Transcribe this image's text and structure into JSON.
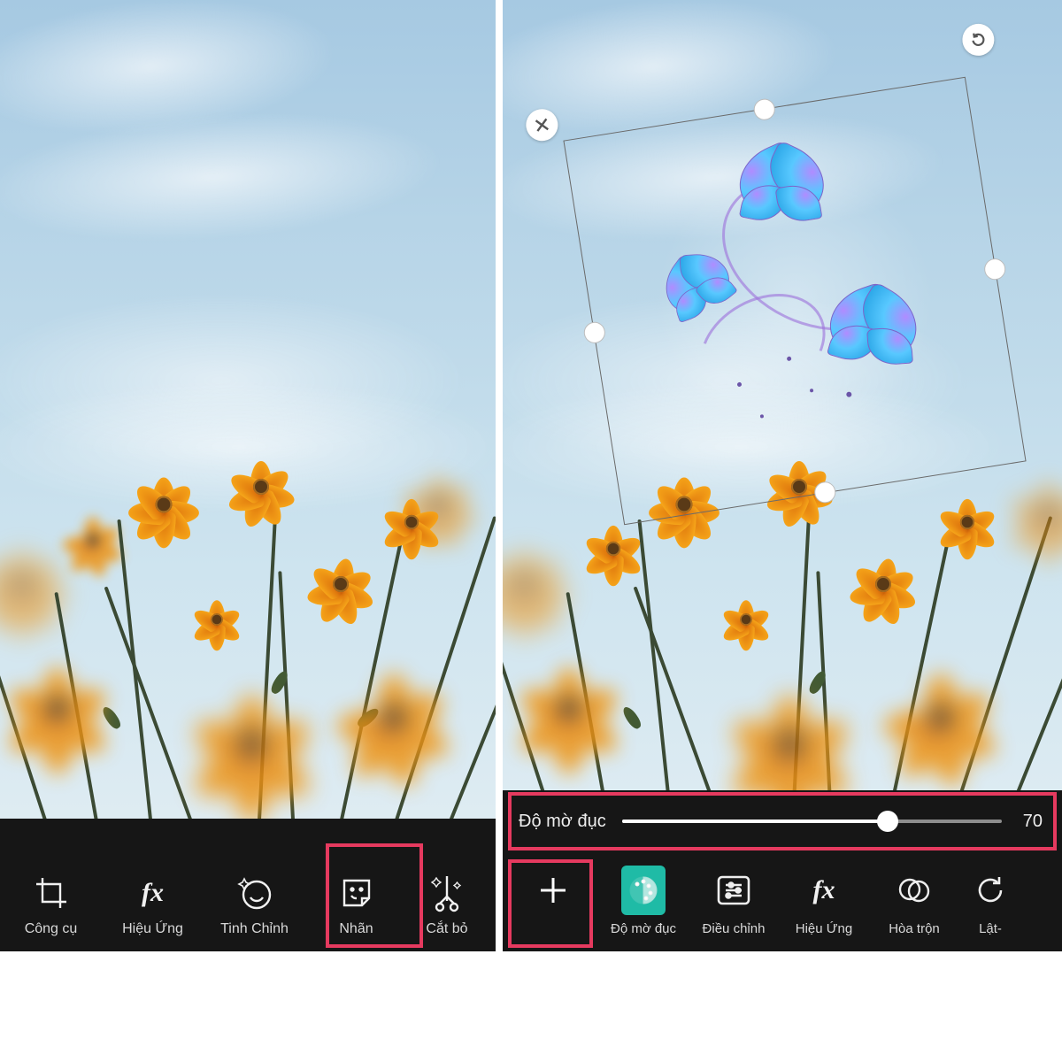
{
  "left": {
    "toolbar": [
      {
        "label": "Công cụ",
        "icon": "crop-icon"
      },
      {
        "label": "Hiệu Ứng",
        "icon": "fx-icon"
      },
      {
        "label": "Tinh Chỉnh",
        "icon": "face-enhance-icon"
      },
      {
        "label": "Nhãn",
        "icon": "sticker-icon"
      },
      {
        "label": "Cắt bỏ",
        "icon": "magic-cut-icon"
      }
    ],
    "highlight_index": 3
  },
  "right": {
    "slider": {
      "label": "Độ mờ đục",
      "value": 70,
      "value_display": "70"
    },
    "selection": {
      "close_aria": "close",
      "rotate_aria": "rotate"
    },
    "toolbar": [
      {
        "label": "",
        "icon": "add-icon",
        "plus_only": true
      },
      {
        "label": "Độ mờ đục",
        "icon": "opacity-icon",
        "active": true
      },
      {
        "label": "Điều chỉnh",
        "icon": "adjust-list-icon"
      },
      {
        "label": "Hiệu Ứng",
        "icon": "fx-icon"
      },
      {
        "label": "Hòa trộn",
        "icon": "blend-icon"
      },
      {
        "label": "Lật-",
        "icon": "undo-rotate-icon"
      }
    ]
  }
}
